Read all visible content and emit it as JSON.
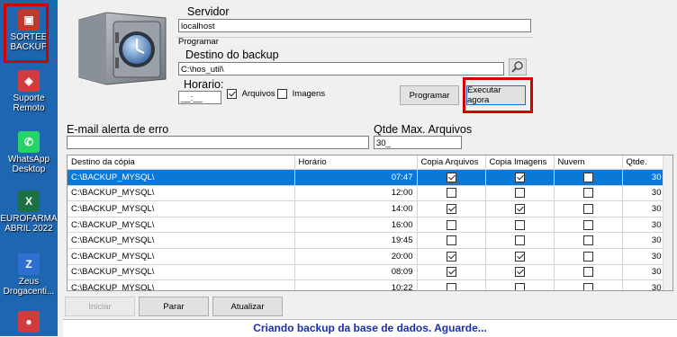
{
  "desktop": {
    "icons": [
      {
        "label": "SORTEE BACKUP",
        "icon": "sortee-backup-icon",
        "color": "#c0392b",
        "highlighted": true
      },
      {
        "label": "Suporte Remoto",
        "icon": "remote-support-icon",
        "color": "#d23b3b"
      },
      {
        "label": "WhatsApp Desktop",
        "icon": "whatsapp-icon",
        "color": "#25d366"
      },
      {
        "label": "EUROFARMA ABRIL 2022",
        "icon": "excel-icon",
        "color": "#1e7145"
      },
      {
        "label": "Zeus Drogacenti...",
        "icon": "zeus-icon",
        "color": "#2f6fd1"
      },
      {
        "label": "",
        "icon": "app-icon",
        "color": "#d23b3b"
      }
    ]
  },
  "form": {
    "servidor_label": "Servidor",
    "servidor_value": "localhost",
    "programar_label": "Programar",
    "destino_label": "Destino do backup",
    "destino_value": "C:\\hos_util\\",
    "horario_label": "Horario:",
    "horario_value": "__:__",
    "arquivos_label": "Arquivos",
    "arquivos_checked": true,
    "imagens_label": "Imagens",
    "imagens_checked": false,
    "programar_button": "Programar",
    "executar_button": "Executar agora",
    "email_label": "E-mail  alerta de erro",
    "email_value": "",
    "qtde_label": "Qtde Max. Arquivos",
    "qtde_value": "30_"
  },
  "table": {
    "columns": [
      "Destino da cópia",
      "Horário",
      "Copia Arquivos",
      "Copia Imagens",
      "Nuvem",
      "Qtde."
    ],
    "rows": [
      {
        "destino": "C:\\BACKUP_MYSQL\\",
        "horario": "07:47",
        "arquivos": true,
        "imagens": true,
        "nuvem": false,
        "qtde": "30",
        "selected": true
      },
      {
        "destino": "C:\\BACKUP_MYSQL\\",
        "horario": "12:00",
        "arquivos": false,
        "imagens": false,
        "nuvem": false,
        "qtde": "30"
      },
      {
        "destino": "C:\\BACKUP_MYSQL\\",
        "horario": "14:00",
        "arquivos": true,
        "imagens": true,
        "nuvem": false,
        "qtde": "30"
      },
      {
        "destino": "C:\\BACKUP_MYSQL\\",
        "horario": "16:00",
        "arquivos": false,
        "imagens": false,
        "nuvem": false,
        "qtde": "30"
      },
      {
        "destino": "C:\\BACKUP_MYSQL\\",
        "horario": "19:45",
        "arquivos": false,
        "imagens": false,
        "nuvem": false,
        "qtde": "30"
      },
      {
        "destino": "C:\\BACKUP_MYSQL\\",
        "horario": "20:00",
        "arquivos": true,
        "imagens": true,
        "nuvem": false,
        "qtde": "30"
      },
      {
        "destino": "C:\\BACKUP_MYSQL\\",
        "horario": "08:09",
        "arquivos": true,
        "imagens": true,
        "nuvem": false,
        "qtde": "30"
      },
      {
        "destino": "C:\\BACKUP_MYSQL\\",
        "horario": "10:22",
        "arquivos": false,
        "imagens": false,
        "nuvem": false,
        "qtde": "30"
      }
    ]
  },
  "footer": {
    "iniciar_button": "Iniciar",
    "parar_button": "Parar",
    "atualizar_button": "Atualizar",
    "status_text": "Criando backup da base de dados. Aguarde..."
  },
  "colors": {
    "selection": "#0a78d7",
    "highlight_box": "#d40000",
    "status_text": "#1a2fa8"
  }
}
